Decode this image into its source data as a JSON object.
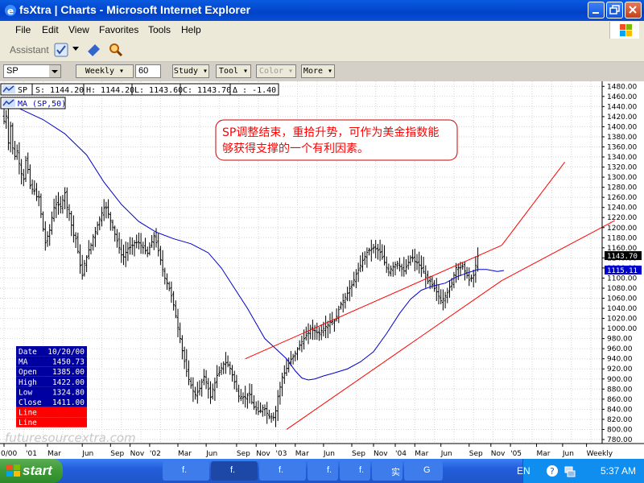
{
  "window": {
    "title": "fsXtra | Charts - Microsoft Internet Explorer"
  },
  "menu": [
    "File",
    "Edit",
    "View",
    "Favorites",
    "Tools",
    "Help"
  ],
  "assistant_label": "Assistant",
  "toolbar": {
    "symbol": "SP",
    "interval": "Weekly",
    "periods": "60",
    "buttons": [
      "Study",
      "Tool",
      "Color",
      "More"
    ]
  },
  "quote": {
    "symbol": "SP",
    "S": "S: 1144.20",
    "H": "H: 1144.20",
    "L": "L: 1143.60",
    "C": "C: 1143.70",
    "delta": "Δ : -1.40"
  },
  "ma_label": "MA (SP,50)",
  "annotation": [
    "SP调整结束，重拾升势，可作为美金指数能",
    "够获得支撑的一个有利因素。"
  ],
  "data_box": [
    [
      "Date",
      "10/20/00"
    ],
    [
      "MA",
      "1450.73"
    ],
    [
      "Open",
      "1385.00"
    ],
    [
      "High",
      "1422.00"
    ],
    [
      "Low",
      "1324.80"
    ],
    [
      "Close",
      "1411.00"
    ],
    [
      "Line",
      ""
    ],
    [
      "Line",
      ""
    ]
  ],
  "watermark": "futuresourcextra.com",
  "price_tag_last": "1143.70",
  "price_tag_ma": "1115.11",
  "colors": {
    "candles": "#000000",
    "ma": "#0000cc",
    "channel": "#ff0000",
    "annotation_text": "#ff0000",
    "databox_bg": "#0000a0",
    "line_rows": "#ff0000"
  },
  "taskbar": {
    "start": "start",
    "items": [
      "f.",
      "f.",
      "f.",
      "f.",
      "f.",
      "实",
      "G"
    ],
    "lang": "EN",
    "clock": "5:37 AM"
  },
  "chart_data": {
    "type": "candlestick",
    "interval": "Weekly",
    "ylim": [
      772,
      1490
    ],
    "y_ticks": [
      780,
      800,
      820,
      840,
      860,
      880,
      900,
      920,
      940,
      960,
      980,
      1000,
      1020,
      1040,
      1060,
      1080,
      1100,
      1120,
      1140,
      1160,
      1180,
      1200,
      1220,
      1240,
      1260,
      1280,
      1300,
      1320,
      1340,
      1360,
      1380,
      1400,
      1420,
      1440,
      1460,
      1480
    ],
    "x_labels": [
      "0/00",
      "'01",
      "Mar",
      "Jun",
      "Sep",
      "Nov",
      "'02",
      "Mar",
      "Jun",
      "Sep",
      "Nov",
      "'03",
      "Mar",
      "Jun",
      "Sep",
      "Nov",
      "'04",
      "Mar",
      "Jun",
      "Sep",
      "Nov",
      "'05",
      "Mar",
      "Jun",
      "Weekly"
    ],
    "x_label_weeks": [
      0,
      10,
      20,
      36,
      49,
      58,
      67,
      80,
      93,
      107,
      116,
      125,
      134,
      147,
      160,
      170,
      180,
      189,
      201,
      214,
      224,
      233,
      245,
      257,
      268
    ],
    "closes": [
      1411,
      1421,
      1368,
      1401,
      1358,
      1341,
      1352,
      1327,
      1307,
      1296,
      1333,
      1315,
      1283,
      1276,
      1273,
      1261,
      1260,
      1227,
      1197,
      1170,
      1183,
      1195,
      1220,
      1240,
      1246,
      1245,
      1242,
      1255,
      1269,
      1240,
      1228,
      1205,
      1185,
      1178,
      1153,
      1125,
      1105,
      1129,
      1141,
      1156,
      1165,
      1182,
      1192,
      1205,
      1217,
      1229,
      1239,
      1239,
      1227,
      1214,
      1201,
      1187,
      1174,
      1160,
      1146,
      1142,
      1151,
      1158,
      1161,
      1165,
      1170,
      1170,
      1170,
      1165,
      1160,
      1154,
      1149,
      1161,
      1172,
      1184,
      1170,
      1154,
      1136,
      1117,
      1100,
      1090,
      1079,
      1065,
      1047,
      1025,
      1002,
      980,
      956,
      935,
      915,
      899,
      887,
      876,
      869,
      874,
      881,
      894,
      905,
      894,
      880,
      864,
      880,
      892,
      907,
      913,
      922,
      930,
      932,
      928,
      921,
      908,
      894,
      880,
      866,
      865,
      864,
      863,
      868,
      869,
      854,
      844,
      839,
      835,
      837,
      843,
      841,
      832,
      826,
      826,
      824,
      837,
      865,
      884,
      904,
      912,
      921,
      931,
      939,
      944,
      951,
      959,
      967,
      974,
      980,
      986,
      992,
      998,
      997,
      996,
      992,
      991,
      996,
      1000,
      1004,
      1007,
      1013,
      1014,
      1015,
      1024,
      1038,
      1049,
      1055,
      1062,
      1070,
      1079,
      1086,
      1096,
      1108,
      1116,
      1125,
      1135,
      1143,
      1151,
      1156,
      1157,
      1160,
      1158,
      1155,
      1151,
      1141,
      1131,
      1121,
      1112,
      1118,
      1123,
      1127,
      1129,
      1123,
      1118,
      1114,
      1122,
      1131,
      1140,
      1139,
      1133,
      1130,
      1126,
      1119,
      1113,
      1102,
      1093,
      1094,
      1087,
      1079,
      1073,
      1064,
      1055,
      1059,
      1065,
      1071,
      1082,
      1090,
      1106,
      1121,
      1121,
      1121,
      1123,
      1114,
      1105,
      1096,
      1100,
      1105,
      1125,
      1143.7
    ],
    "ma_50": [
      [
        0,
        1450.7
      ],
      [
        8,
        1434
      ],
      [
        18,
        1414
      ],
      [
        28,
        1386
      ],
      [
        38,
        1344
      ],
      [
        46,
        1290
      ],
      [
        54,
        1246
      ],
      [
        62,
        1212
      ],
      [
        70,
        1191
      ],
      [
        78,
        1178
      ],
      [
        86,
        1168
      ],
      [
        94,
        1150
      ],
      [
        100,
        1120
      ],
      [
        106,
        1080
      ],
      [
        112,
        1040
      ],
      [
        116,
        1010
      ],
      [
        120,
        980
      ],
      [
        125,
        960
      ],
      [
        130,
        940
      ],
      [
        134,
        916
      ],
      [
        137,
        902
      ],
      [
        140,
        898
      ],
      [
        143,
        900
      ],
      [
        147,
        906
      ],
      [
        152,
        912
      ],
      [
        158,
        920
      ],
      [
        164,
        934
      ],
      [
        170,
        954
      ],
      [
        176,
        990
      ],
      [
        182,
        1030
      ],
      [
        187,
        1058
      ],
      [
        192,
        1076
      ],
      [
        197,
        1084
      ],
      [
        203,
        1090
      ],
      [
        208,
        1102
      ],
      [
        213,
        1110
      ],
      [
        218,
        1117
      ],
      [
        222,
        1117
      ],
      [
        227,
        1113
      ],
      [
        230,
        1115.11
      ]
    ],
    "channel_lines": [
      {
        "points": [
          [
            111,
            940
          ],
          [
            229,
            1165
          ],
          [
            258,
            1330
          ]
        ]
      },
      {
        "points": [
          [
            130,
            800
          ],
          [
            229,
            1095
          ],
          [
            281,
            1214
          ]
        ]
      }
    ]
  }
}
